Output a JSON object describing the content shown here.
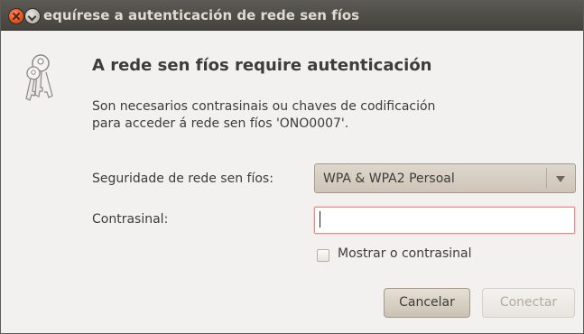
{
  "window": {
    "title": "equírese a autenticación de rede sen fíos"
  },
  "dialog": {
    "heading": "A rede sen fíos require autenticación",
    "description_line1": "Son necesarios contrasinais ou chaves de codificación",
    "description_line2": "para acceder á rede sen fíos 'ONO0007'."
  },
  "form": {
    "security_label": "Seguridade de rede sen fíos:",
    "security_value": "WPA & WPA2 Persoal",
    "password_label": "Contrasinal:",
    "password_value": "",
    "show_password_label": "Mostrar o contrasinal",
    "show_password_checked": false
  },
  "buttons": {
    "cancel": "Cancelar",
    "connect": "Conectar"
  },
  "icons": {
    "window_close": "close-icon",
    "window_menu": "chevron-down-icon",
    "dialog_icon": "keys-icon"
  },
  "colors": {
    "titlebar": "#4d4c47",
    "close_button": "#e2531f",
    "input_focus_border": "#e0908a"
  }
}
